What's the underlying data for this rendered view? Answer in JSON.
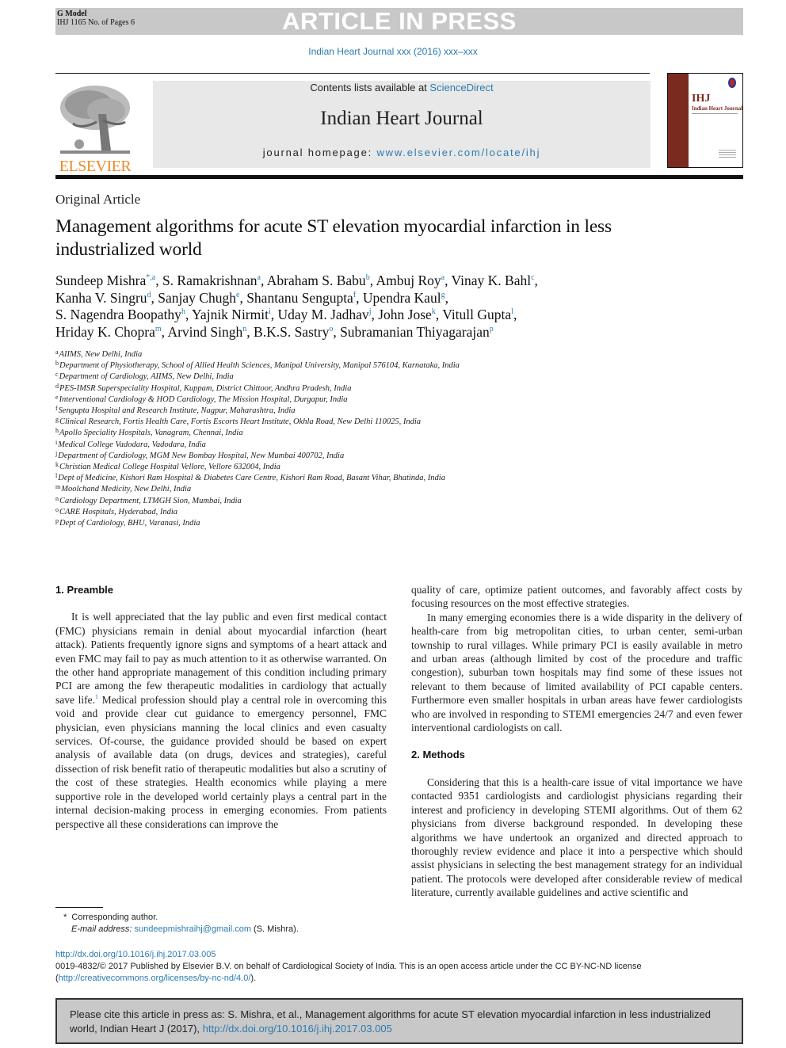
{
  "header": {
    "gmodel": "G Model",
    "ms_info": "IHJ 1165 No. of Pages 6",
    "banner": "ARTICLE IN PRESS",
    "running_head": "Indian Heart Journal xxx (2016) xxx–xxx"
  },
  "masthead": {
    "publisher_logo_text": "ELSEVIER",
    "contents_prefix": "Contents lists available at ",
    "contents_link": "ScienceDirect",
    "journal_title": "Indian Heart Journal",
    "homepage_prefix": "journal homepage: ",
    "homepage_link": "www.elsevier.com/locate/ihj",
    "cover_abbrev": "IHJ",
    "cover_title": "Indian Heart Journal"
  },
  "article": {
    "type": "Original Article",
    "title": "Management algorithms for acute ST elevation myocardial infarction in less industrialized world",
    "authors": [
      {
        "name": "Sundeep Mishra",
        "sup": "*,a",
        "sep": ", "
      },
      {
        "name": "S. Ramakrishnan",
        "sup": "a",
        "sep": ", "
      },
      {
        "name": "Abraham S. Babu",
        "sup": "b",
        "sep": ", "
      },
      {
        "name": "Ambuj Roy",
        "sup": "a",
        "sep": ", "
      },
      {
        "name": "Vinay K. Bahl",
        "sup": "c",
        "sep": ","
      },
      {
        "name": "Kanha V. Singru",
        "sup": "d",
        "sep": ", "
      },
      {
        "name": "Sanjay Chugh",
        "sup": "e",
        "sep": ", "
      },
      {
        "name": "Shantanu Sengupta",
        "sup": "f",
        "sep": ", "
      },
      {
        "name": "Upendra Kaul",
        "sup": "g",
        "sep": ","
      },
      {
        "name": "S. Nagendra Boopathy",
        "sup": "h",
        "sep": ", "
      },
      {
        "name": "Yajnik Nirmit",
        "sup": "i",
        "sep": ", "
      },
      {
        "name": "Uday M. Jadhav",
        "sup": "j",
        "sep": ", "
      },
      {
        "name": "John Jose",
        "sup": "k",
        "sep": ", "
      },
      {
        "name": "Vitull Gupta",
        "sup": "l",
        "sep": ","
      },
      {
        "name": "Hriday K. Chopra",
        "sup": "m",
        "sep": ", "
      },
      {
        "name": "Arvind Singh",
        "sup": "n",
        "sep": ", "
      },
      {
        "name": "B.K.S. Sastry",
        "sup": "o",
        "sep": ", "
      },
      {
        "name": "Subramanian Thiyagarajan",
        "sup": "p",
        "sep": ""
      }
    ],
    "affiliations": [
      {
        "key": "a",
        "text": "AIIMS, New Delhi, India"
      },
      {
        "key": "b",
        "text": "Department of Physiotherapy, School of Allied Health Sciences, Manipal University, Manipal 576104, Karnataka, India"
      },
      {
        "key": "c",
        "text": "Department of Cardiology, AIIMS, New Delhi, India"
      },
      {
        "key": "d",
        "text": "PES-IMSR Superspeciality Hospital, Kuppam, District Chittoor, Andhra Pradesh, India"
      },
      {
        "key": "e",
        "text": "Interventional Cardiology & HOD Cardiology, The Mission Hospital, Durgapur, India"
      },
      {
        "key": "f",
        "text": "Sengupta Hospital and Research Institute, Nagpur, Maharashtra, India"
      },
      {
        "key": "g",
        "text": "Clinical Research, Fortis Health Care, Fortis Escorts Heart Institute, Okhla Road, New Delhi 110025, India"
      },
      {
        "key": "h",
        "text": "Apollo Speciality Hospitals, Vanagram, Chennai, India"
      },
      {
        "key": "i",
        "text": "Medical College Vadodara, Vadodara, India"
      },
      {
        "key": "j",
        "text": "Department of Cardiology, MGM New Bombay Hospital, New Mumbai 400702, India"
      },
      {
        "key": "k",
        "text": "Christian Medical College Hospital Vellore, Vellore 632004, India"
      },
      {
        "key": "l",
        "text": "Dept of Medicine, Kishori Ram Hospital & Diabetes Care Centre, Kishori Ram Road, Basant Vihar, Bhatinda, India"
      },
      {
        "key": "m",
        "text": "Moolchand Medicity, New Delhi, India"
      },
      {
        "key": "n",
        "text": "Cardiology Department, LTMGH Sion, Mumbai, India"
      },
      {
        "key": "o",
        "text": "CARE Hospitals, Hyderabad, India"
      },
      {
        "key": "p",
        "text": "Dept of Cardiology, BHU, Varanasi, India"
      }
    ]
  },
  "body": {
    "preamble": {
      "heading": "1. Preamble",
      "p1_before_ref": "It is well appreciated that the lay public and even first medical contact (FMC) physicians remain in denial about myocardial infarction (heart attack). Patients frequently ignore signs and symptoms of a heart attack and even FMC may fail to pay as much attention to it as otherwise warranted. On the other hand appropriate management of this condition including primary PCI are among the few therapeutic modalities in cardiology that actually save life.",
      "p1_ref": "1",
      "p1_after_ref": " Medical profession should play a central role in overcoming this void and provide clear cut guidance to emergency personnel, FMC physician, even physicians manning the local clinics and even casualty services. Of-course, the guidance provided should be based on expert analysis of available data (on drugs, devices and strategies), careful dissection of risk benefit ratio of therapeutic modalities but also a scrutiny of the cost of these strategies. Health economics while playing a mere supportive role in the developed world certainly plays a central part in the internal decision-making process in emerging economies. From patients perspective all these considerations can improve the",
      "p1_continued": "quality of care, optimize patient outcomes, and favorably affect costs by focusing resources on the most effective strategies.",
      "p2": "In many emerging economies there is a wide disparity in the delivery of health-care from big metropolitan cities, to urban center, semi-urban township to rural villages. While primary PCI is easily available in metro and urban areas (although limited by cost of the procedure and traffic congestion), suburban town hospitals may find some of these issues not relevant to them because of limited availability of PCI capable centers. Furthermore even smaller hospitals in urban areas have fewer cardiologists who are involved in responding to STEMI emergencies 24/7 and even fewer interventional cardiologists on call."
    },
    "methods": {
      "heading": "2. Methods",
      "p1": "Considering that this is a health-care issue of vital importance we have contacted 9351 cardiologists and cardiologist physicians regarding their interest and proficiency in developing STEMI algorithms. Out of them 62 physicians from diverse background responded. In developing these algorithms we have undertook an organized and directed approach to thoroughly review evidence and place it into a perspective which should assist physicians in selecting the best management strategy for an individual patient. The protocols were developed after considerable review of medical literature, currently available guidelines and active scientific and"
    }
  },
  "footnote": {
    "marker": "*",
    "corresponding": "Corresponding author.",
    "email_label": "E-mail address:",
    "email": "sundeepmishraihj@gmail.com",
    "email_suffix": " (S. Mishra)."
  },
  "doi_block": {
    "doi_url": "http://dx.doi.org/10.1016/j.ihj.2017.03.005",
    "license_text": "0019-4832/© 2017 Published by Elsevier B.V. on behalf of Cardiological Society of India. This is an open access article under the CC BY-NC-ND license (",
    "license_url": "http://creativecommons.org/licenses/by-nc-nd/4.0/",
    "license_end": ")."
  },
  "citation": {
    "text": "Please cite this article in press as: S. Mishra, et al., Management algorithms for acute ST elevation myocardial infarction in less industrialized world, Indian Heart J (2017), ",
    "url": "http://dx.doi.org/10.1016/j.ihj.2017.03.005"
  }
}
